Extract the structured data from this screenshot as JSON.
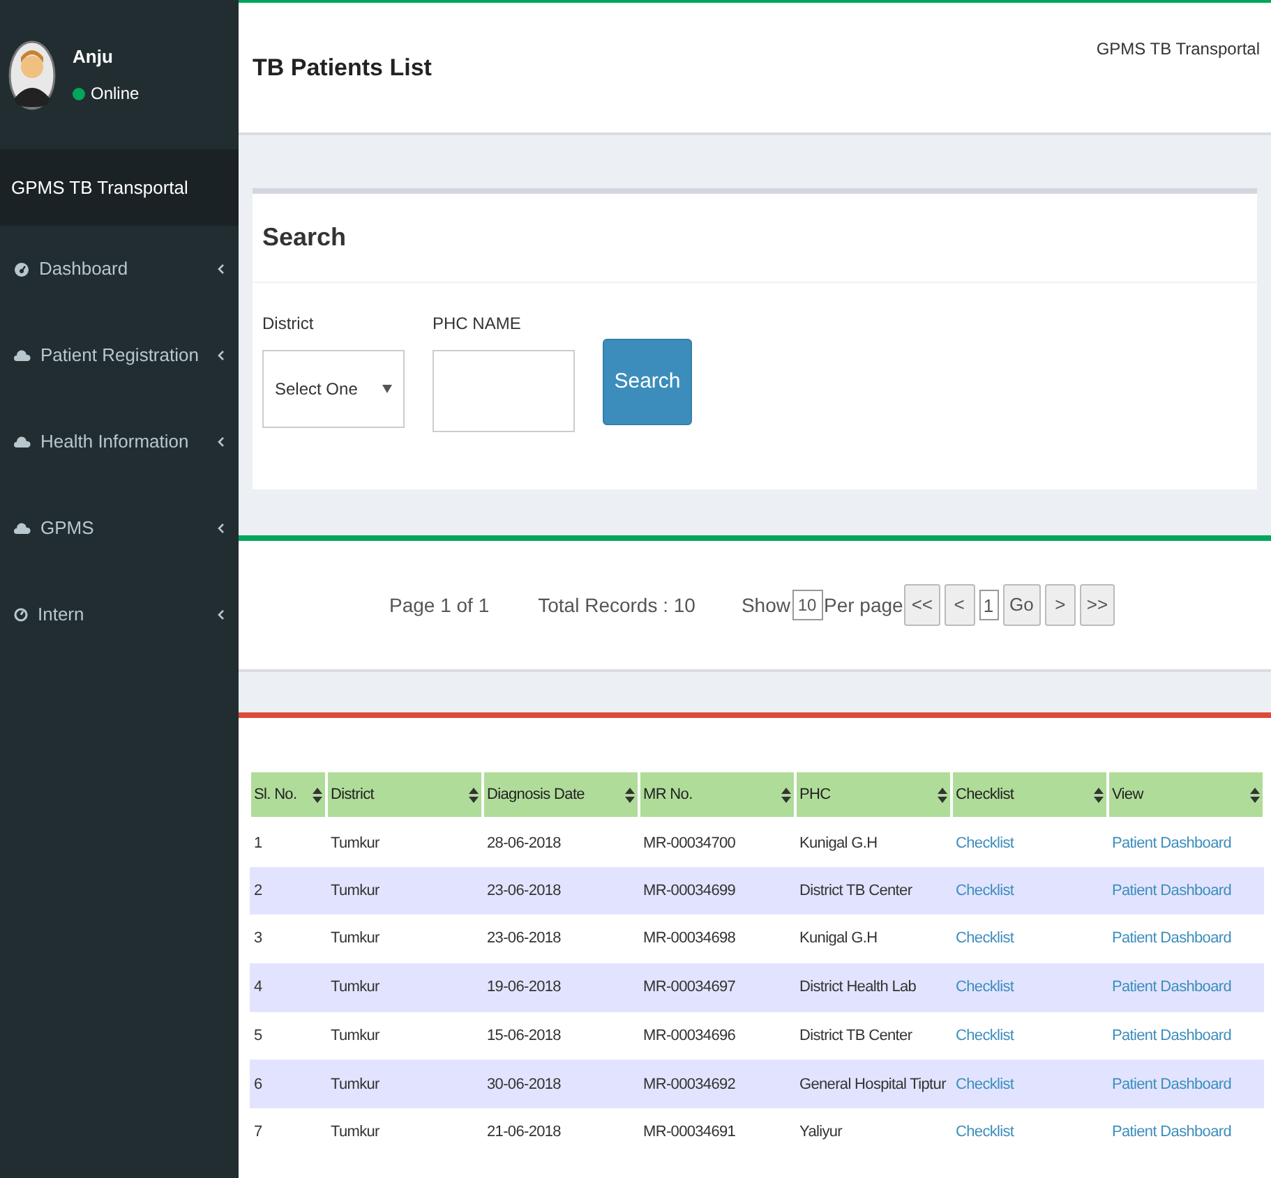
{
  "user": {
    "name": "Anju",
    "status": "Online",
    "online": true
  },
  "sidebar": {
    "brand": "GPMS TB Transportal",
    "items": [
      {
        "kind": "dashboard",
        "label": "Dashboard",
        "expanded": false
      },
      {
        "kind": "cloud",
        "label": "Patient Registration",
        "expanded": false
      },
      {
        "kind": "cloud",
        "label": "Health Information",
        "expanded": false
      },
      {
        "kind": "cloud",
        "label": "GPMS",
        "expanded": false
      },
      {
        "kind": "circle",
        "label": "Intern",
        "expanded": false
      }
    ]
  },
  "header": {
    "title": "TB Patients List",
    "brand": "GPMS TB Transportal"
  },
  "search": {
    "title": "Search",
    "district_label": "District",
    "district_value": "Select One",
    "phc_label": "PHC NAME",
    "button": "Search"
  },
  "pager": {
    "page": "Page 1 of 1",
    "total": "Total Records : 10",
    "show": "Show",
    "per_page_value": "10",
    "per_page": "Per page",
    "buttons": [
      "<<",
      "<"
    ],
    "page_value": "1",
    "go": "Go",
    "next_buttons": [
      ">",
      ">>"
    ]
  },
  "table": {
    "columns": [
      "Sl. No.",
      "District",
      "Diagnosis Date",
      "MR No.",
      "PHC",
      "Checklist",
      "View"
    ],
    "rows": [
      [
        "1",
        "Tumkur",
        "28-06-2018",
        "MR-00034700",
        "Kunigal G.H",
        "Checklist",
        "Patient Dashboard"
      ],
      [
        "2",
        "Tumkur",
        "23-06-2018",
        "MR-00034699",
        "District TB Center",
        "Checklist",
        "Patient Dashboard"
      ],
      [
        "3",
        "Tumkur",
        "23-06-2018",
        "MR-00034698",
        "Kunigal G.H",
        "Checklist",
        "Patient Dashboard"
      ],
      [
        "4",
        "Tumkur",
        "19-06-2018",
        "MR-00034697",
        "District Health Lab",
        "Checklist",
        "Patient Dashboard"
      ],
      [
        "5",
        "Tumkur",
        "15-06-2018",
        "MR-00034696",
        "District TB Center",
        "Checklist",
        "Patient Dashboard"
      ],
      [
        "6",
        "Tumkur",
        "30-06-2018",
        "MR-00034692",
        "General Hospital Tiptur",
        "Checklist",
        "Patient Dashboard"
      ],
      [
        "7",
        "Tumkur",
        "21-06-2018",
        "MR-00034691",
        "Yaliyur",
        "Checklist",
        "Patient Dashboard"
      ]
    ]
  }
}
